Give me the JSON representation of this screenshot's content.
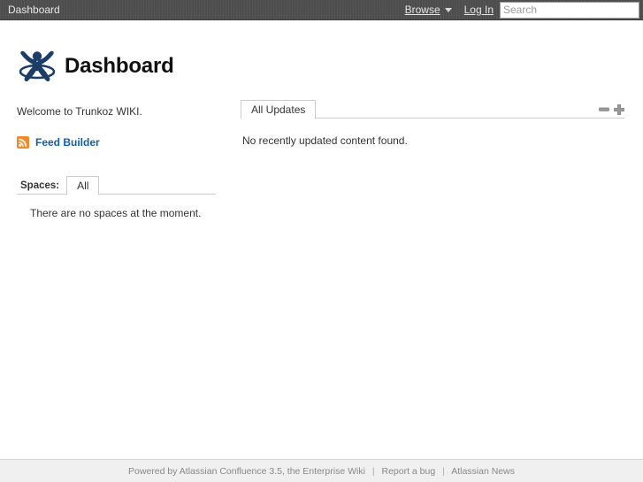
{
  "header": {
    "dashboard_label": "Dashboard",
    "browse_label": "Browse",
    "login_label": "Log In",
    "search_placeholder": "Search",
    "search_value": "",
    "bar_color": "#4d4d4d",
    "text_color": "#e8e8e8"
  },
  "page": {
    "title": "Dashboard",
    "logo_name": "confluence-logo",
    "logo_color": "#1c3d68"
  },
  "left": {
    "welcome_text": "Welcome to Trunkoz WIKI.",
    "feed_builder_label": "Feed Builder",
    "feed_builder_color": "#1060a8",
    "rss_icon_color": "#ef8b2c"
  },
  "spaces": {
    "label": "Spaces:",
    "tabs": [
      {
        "label": "All",
        "active": true
      }
    ],
    "empty_message": "There are no spaces at the moment."
  },
  "updates": {
    "tabs": [
      {
        "label": "All Updates",
        "active": true
      }
    ],
    "empty_message": "No recently updated content found.",
    "controls": [
      {
        "name": "collapse-icon",
        "glyph": "minus"
      },
      {
        "name": "expand-icon",
        "glyph": "plus"
      }
    ]
  },
  "footer": {
    "powered_by": "Powered by Atlassian Confluence 3.5, the Enterprise Wiki",
    "separator": "|",
    "report_bug": "Report a bug",
    "atlassian_news": "Atlassian News",
    "text_color": "#888888"
  }
}
